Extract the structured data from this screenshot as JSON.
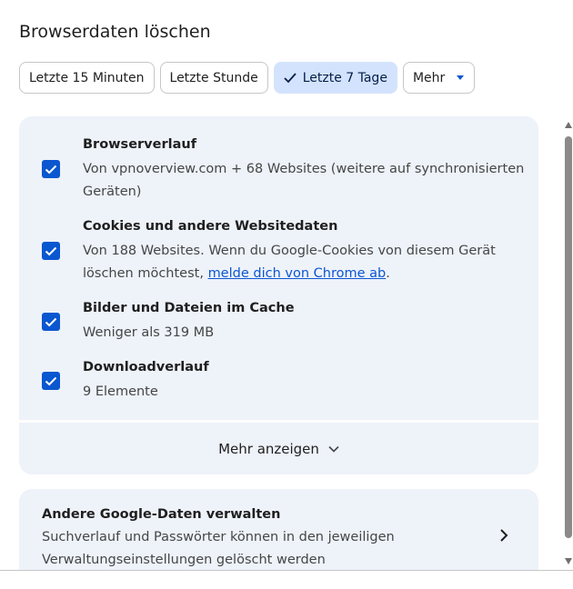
{
  "dialog": {
    "title": "Browserdaten löschen"
  },
  "time_range": {
    "chips": [
      {
        "label": "Letzte 15 Minuten",
        "selected": false
      },
      {
        "label": "Letzte Stunde",
        "selected": false
      },
      {
        "label": "Letzte 7 Tage",
        "selected": true
      },
      {
        "label": "Mehr",
        "selected": false
      }
    ]
  },
  "items": [
    {
      "title": "Browserverlauf",
      "desc": "Von vpnoverview.com + 68 Websites (weitere auf synchronisierten Geräten)",
      "checked": true
    },
    {
      "title": "Cookies und andere Websitedaten",
      "desc_prefix": "Von 188 Websites. Wenn du Google-Cookies von diesem Gerät löschen möchtest, ",
      "desc_link": "melde dich von Chrome ab",
      "desc_suffix": ".",
      "checked": true
    },
    {
      "title": "Bilder und Dateien im Cache",
      "desc": "Weniger als 319 MB",
      "checked": true
    },
    {
      "title": "Downloadverlauf",
      "desc": "9 Elemente",
      "checked": true
    }
  ],
  "more_button": {
    "label": "Mehr anzeigen"
  },
  "manage": {
    "title": "Andere Google-Daten verwalten",
    "desc": "Suchverlauf und Passwörter können in den jeweiligen Verwaltungseinstellungen gelöscht werden"
  },
  "colors": {
    "accent": "#0b57d0",
    "selected_chip_bg": "#d3e3fd",
    "panel_bg": "#eef2f9"
  }
}
